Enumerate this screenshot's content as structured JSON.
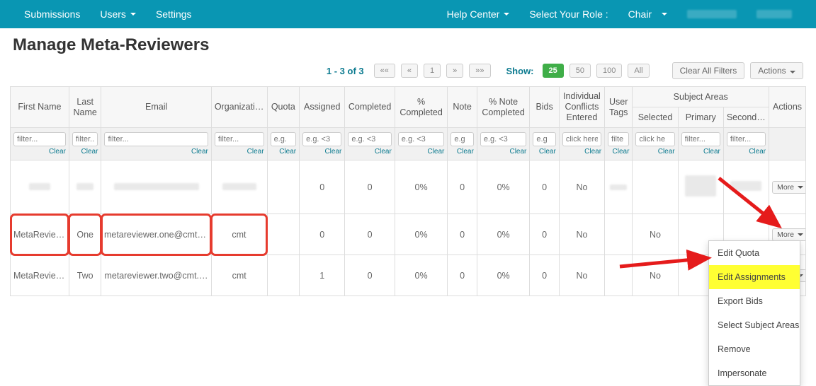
{
  "nav": {
    "submissions": "Submissions",
    "users": "Users",
    "settings": "Settings",
    "help": "Help Center",
    "role_label": "Select Your Role :",
    "role_value": "Chair"
  },
  "title": "Manage Meta-Reviewers",
  "paging": {
    "range": "1 - 3 of 3",
    "first": "««",
    "prev": "«",
    "page": "1",
    "next": "»",
    "last": "»»"
  },
  "show": {
    "label": "Show:",
    "opts": [
      "25",
      "50",
      "100",
      "All"
    ]
  },
  "toolbar": {
    "clear_filters": "Clear All Filters",
    "actions": "Actions"
  },
  "cols": {
    "first": "First Name",
    "last": "Last Name",
    "email": "Email",
    "org": "Organization",
    "quota": "Quota",
    "assigned": "Assigned",
    "completed": "Completed",
    "pct_completed": "% Completed",
    "note": "Note",
    "pct_note": "% Note Completed",
    "bids": "Bids",
    "conflicts": "Individual Conflicts Entered",
    "tags": "User Tags",
    "subject_areas": "Subject Areas",
    "selected": "Selected",
    "primary": "Primary",
    "secondary": "Secondary",
    "actions": "Actions"
  },
  "filters": {
    "text": "filter...",
    "eg": "e.g. <3",
    "egshort": "e.g",
    "click": "click here",
    "filt": "filte",
    "clear": "Clear"
  },
  "rows": [
    {
      "first": "",
      "last": "",
      "email": "",
      "org": "",
      "quota": "",
      "assigned": "0",
      "completed": "0",
      "pct": "0%",
      "note": "0",
      "pctnote": "0%",
      "bids": "0",
      "conflicts": "No",
      "tags": "",
      "selected": "",
      "primary": "",
      "secondary": ""
    },
    {
      "first": "MetaReviewer",
      "last": "One",
      "email": "metareviewer.one@cmt.cmt",
      "org": "cmt",
      "quota": "",
      "assigned": "0",
      "completed": "0",
      "pct": "0%",
      "note": "0",
      "pctnote": "0%",
      "bids": "0",
      "conflicts": "No",
      "tags": "",
      "selected": "No",
      "primary": "",
      "secondary": ""
    },
    {
      "first": "MetaReviewer",
      "last": "Two",
      "email": "metareviewer.two@cmt.cmt",
      "org": "cmt",
      "quota": "",
      "assigned": "1",
      "completed": "0",
      "pct": "0%",
      "note": "0",
      "pctnote": "0%",
      "bids": "0",
      "conflicts": "No",
      "tags": "",
      "selected": "No",
      "primary": "",
      "secondary": ""
    }
  ],
  "more_label": "More",
  "dropdown": {
    "edit_quota": "Edit Quota",
    "edit_assign": "Edit Assignments",
    "export_bids": "Export Bids",
    "select_subj": "Select Subject Areas",
    "remove": "Remove",
    "impersonate": "Impersonate"
  }
}
